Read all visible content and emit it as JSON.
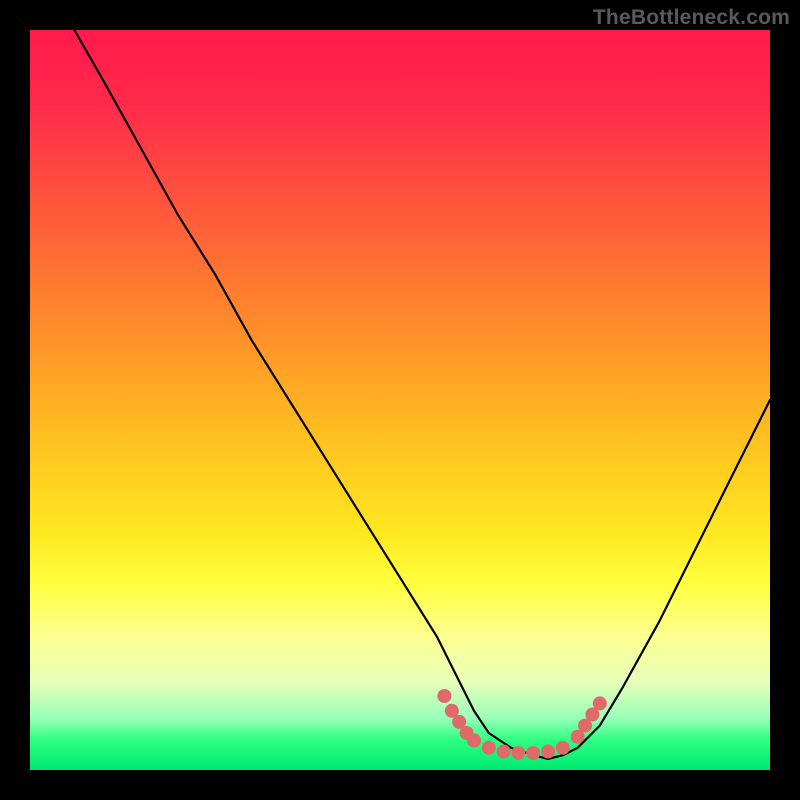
{
  "watermark": {
    "text": "TheBottleneck.com"
  },
  "colors": {
    "gradient_top": "#ff1a4d",
    "gradient_mid": "#ffe820",
    "gradient_bottom": "#00e874",
    "curve": "#000000",
    "accent_dots": "#e06a6a",
    "frame": "#000000"
  },
  "chart_data": {
    "type": "line",
    "title": "",
    "xlabel": "",
    "ylabel": "",
    "xlim": [
      0,
      100
    ],
    "ylim": [
      0,
      100
    ],
    "grid": false,
    "legend": false,
    "series": [
      {
        "name": "bottleneck-curve",
        "x": [
          6,
          10,
          15,
          20,
          25,
          30,
          35,
          40,
          45,
          50,
          55,
          58,
          60,
          62,
          65,
          68,
          70,
          72,
          74,
          77,
          80,
          85,
          90,
          95,
          100
        ],
        "y": [
          100,
          93,
          84,
          75,
          67,
          58,
          50,
          42,
          34,
          26,
          18,
          12,
          8,
          5,
          3,
          2,
          1.5,
          2,
          3,
          6,
          11,
          20,
          30,
          40,
          50
        ]
      }
    ],
    "annotations": [
      {
        "type": "dot-cluster",
        "name": "optimal-range-markers",
        "color": "#e06a6a",
        "points": [
          {
            "x": 56,
            "y": 10
          },
          {
            "x": 57,
            "y": 8
          },
          {
            "x": 58,
            "y": 6.5
          },
          {
            "x": 59,
            "y": 5
          },
          {
            "x": 60,
            "y": 4
          },
          {
            "x": 62,
            "y": 3
          },
          {
            "x": 64,
            "y": 2.5
          },
          {
            "x": 66,
            "y": 2.3
          },
          {
            "x": 68,
            "y": 2.3
          },
          {
            "x": 70,
            "y": 2.5
          },
          {
            "x": 72,
            "y": 3
          },
          {
            "x": 74,
            "y": 4.5
          },
          {
            "x": 75,
            "y": 6
          },
          {
            "x": 76,
            "y": 7.5
          },
          {
            "x": 77,
            "y": 9
          }
        ]
      }
    ]
  }
}
